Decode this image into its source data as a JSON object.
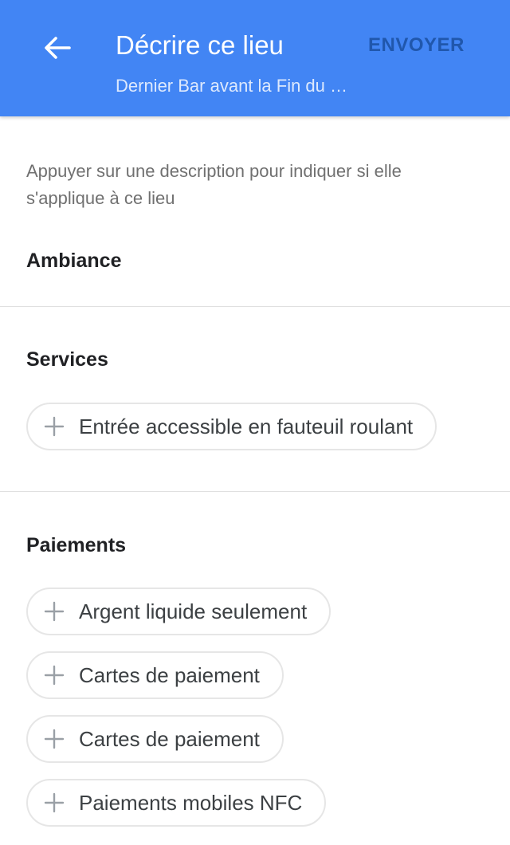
{
  "header": {
    "title": "Décrire ce lieu",
    "subtitle": "Dernier Bar avant la Fin du …",
    "send_label": "ENVOYER",
    "back_icon": "arrow-left-icon",
    "background_color": "#4285f4"
  },
  "hint": "Appuyer sur une description pour indiquer si elle s'applique à ce lieu",
  "sections": [
    {
      "title": "Ambiance",
      "chips": []
    },
    {
      "title": "Services",
      "chips": [
        {
          "label": "Entrée accessible en fauteuil roulant",
          "icon": "plus-icon"
        }
      ]
    },
    {
      "title": "Paiements",
      "chips": [
        {
          "label": "Argent liquide seulement",
          "icon": "plus-icon"
        },
        {
          "label": "Cartes de paiement",
          "icon": "plus-icon"
        },
        {
          "label": "Cartes de paiement",
          "icon": "plus-icon"
        },
        {
          "label": "Paiements mobiles NFC",
          "icon": "plus-icon"
        }
      ]
    }
  ]
}
